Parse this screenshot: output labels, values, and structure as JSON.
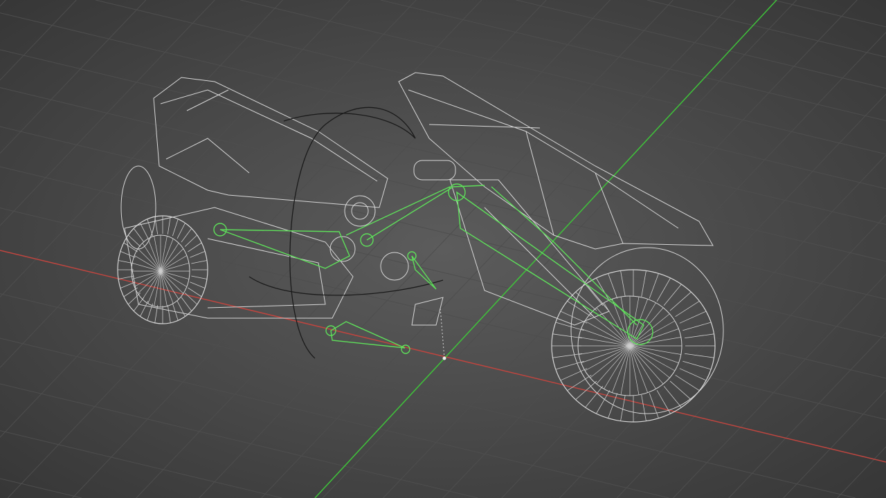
{
  "viewport": {
    "mode": "wireframe",
    "colors": {
      "background_center": "#5a5a5a",
      "background_edge": "#353535",
      "grid": "#4e4e4e",
      "x_axis": "#c0453f",
      "y_axis": "#3fc43a",
      "wire": "#d8d8d8",
      "bone": "#5ee05a",
      "curve": "#1a1a1a"
    }
  }
}
